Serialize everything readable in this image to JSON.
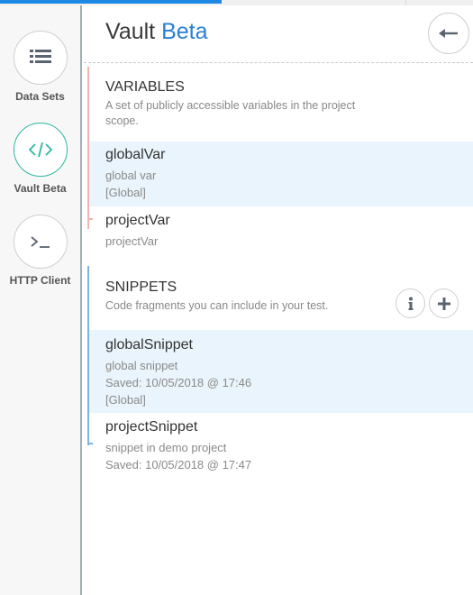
{
  "colors": {
    "accent": "#2a7fd4",
    "active_ring": "#2fb7a0",
    "variables_bar": "#f2b3ac",
    "snippets_bar": "#7cb3e0",
    "selected_row": "#eaf4fc"
  },
  "sidebar": {
    "items": [
      {
        "label": "Data Sets",
        "icon": "list-icon"
      },
      {
        "label": "Vault Beta",
        "icon": "code-icon",
        "active": true
      },
      {
        "label": "HTTP Client",
        "icon": "terminal-icon"
      }
    ]
  },
  "header": {
    "title_main": "Vault",
    "title_accent": "Beta",
    "back_icon": "arrow-left-icon"
  },
  "variables": {
    "title": "VARIABLES",
    "description": "A set of publicly accessible variables in the project scope.",
    "items": [
      {
        "name": "globalVar",
        "description": "global var",
        "scope": "[Global]",
        "selected": true
      },
      {
        "name": "projectVar",
        "description": "projectVar"
      }
    ]
  },
  "snippets": {
    "title": "SNIPPETS",
    "description": "Code fragments you can include in your test.",
    "info_icon": "info-icon",
    "add_icon": "plus-icon",
    "items": [
      {
        "name": "globalSnippet",
        "description": "global snippet",
        "saved": "Saved: 10/05/2018 @ 17:46",
        "scope": "[Global]",
        "selected": true
      },
      {
        "name": "projectSnippet",
        "description": "snippet in demo project",
        "saved": "Saved: 10/05/2018 @ 17:47"
      }
    ]
  }
}
